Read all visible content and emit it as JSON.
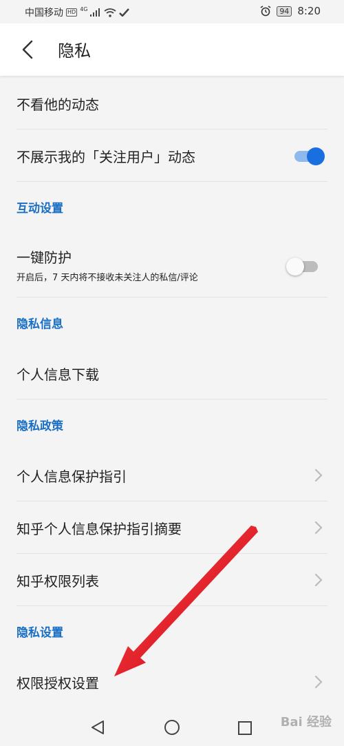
{
  "status": {
    "carrier": "中国移动",
    "hd": "HD",
    "network": "4G",
    "battery": "94",
    "time": "8:20"
  },
  "header": {
    "title": "隐私"
  },
  "rows": {
    "hide_activity": "不看他的动态",
    "no_follow_activity": "不展示我的「关注用户」动态",
    "one_key_protect": "一键防护",
    "one_key_protect_desc": "开启后，7 天内将不接收未关注人的私信/评论",
    "download_info": "个人信息下载",
    "protect_guide": "个人信息保护指引",
    "guide_summary": "知乎个人信息保护指引摘要",
    "permission_list": "知乎权限列表",
    "auth_settings": "权限授权设置"
  },
  "sections": {
    "interaction": "互动设置",
    "privacy_info": "隐私信息",
    "privacy_policy": "隐私政策",
    "privacy_settings": "隐私设置"
  },
  "toggles": {
    "no_follow_activity": true,
    "one_key_protect": false
  },
  "watermark": "Bai 经验",
  "colors": {
    "accent": "#1a6fe0",
    "section_title": "#1a6fc4",
    "annotation_arrow": "#e0141e"
  },
  "icons": {
    "back": "back-chevron-icon",
    "row_arrow": "chevron-right-icon",
    "nav_back": "triangle-back-icon",
    "nav_home": "circle-home-icon",
    "nav_recent": "square-recent-icon"
  }
}
